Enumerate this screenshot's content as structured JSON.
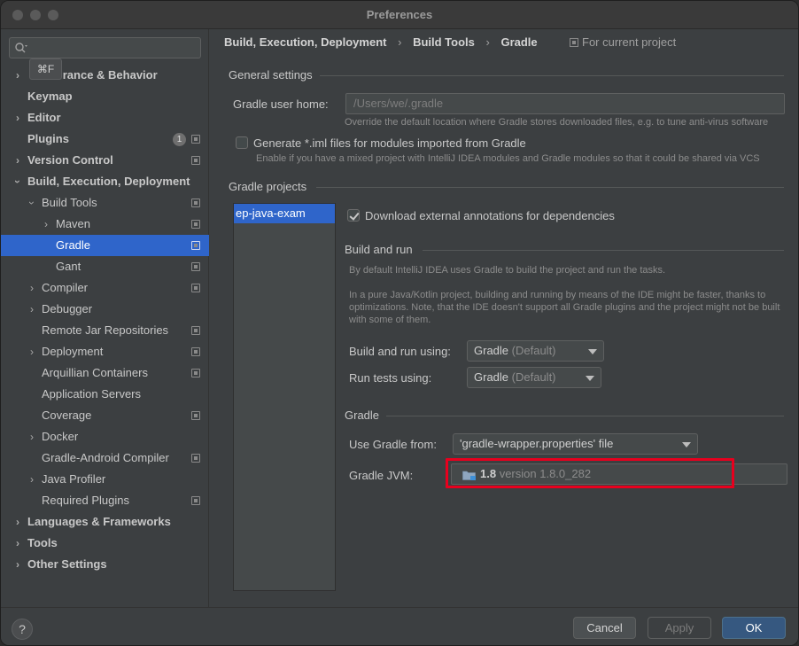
{
  "window": {
    "title": "Preferences"
  },
  "search": {
    "placeholder": "",
    "shortcut_tooltip": "⌘F"
  },
  "sidebar": {
    "items": [
      {
        "label": "Appearance & Behavior",
        "visible_label": "rance & Behavior"
      },
      {
        "label": "Keymap"
      },
      {
        "label": "Editor"
      },
      {
        "label": "Plugins",
        "badge": "1"
      },
      {
        "label": "Version Control"
      },
      {
        "label": "Build, Execution, Deployment"
      },
      {
        "label": "Build Tools"
      },
      {
        "label": "Maven"
      },
      {
        "label": "Gradle"
      },
      {
        "label": "Gant"
      },
      {
        "label": "Compiler"
      },
      {
        "label": "Debugger"
      },
      {
        "label": "Remote Jar Repositories"
      },
      {
        "label": "Deployment"
      },
      {
        "label": "Arquillian Containers"
      },
      {
        "label": "Application Servers"
      },
      {
        "label": "Coverage"
      },
      {
        "label": "Docker"
      },
      {
        "label": "Gradle-Android Compiler"
      },
      {
        "label": "Java Profiler"
      },
      {
        "label": "Required Plugins"
      },
      {
        "label": "Languages & Frameworks"
      },
      {
        "label": "Tools"
      },
      {
        "label": "Other Settings"
      }
    ]
  },
  "breadcrumb": {
    "parts": [
      "Build, Execution, Deployment",
      "Build Tools",
      "Gradle"
    ],
    "separator": "›",
    "scope": "For current project"
  },
  "general": {
    "title": "General settings",
    "user_home_label": "Gradle user home:",
    "user_home_placeholder": "/Users/we/.gradle",
    "user_home_hint": "Override the default location where Gradle stores downloaded files, e.g. to tune anti-virus software",
    "iml_label": "Generate *.iml files for modules imported from Gradle",
    "iml_checked": false,
    "iml_hint": "Enable if you have a mixed project with IntelliJ IDEA modules and Gradle modules so that it could be shared via VCS"
  },
  "projects": {
    "title": "Gradle projects",
    "list": [
      "ep-java-exam"
    ],
    "download_annotations_label": "Download external annotations for dependencies",
    "download_annotations_checked": true,
    "build_run": {
      "title": "Build and run",
      "hint1": "By default IntelliJ IDEA uses Gradle to build the project and run the tasks.",
      "hint2_line1": "In a pure Java/Kotlin project, building and running by means of the IDE might be faster, thanks to",
      "hint2_line2": "optimizations. Note, that the IDE doesn't support all Gradle plugins and the project might not be built",
      "hint2_line3": "with some of them.",
      "build_using_label": "Build and run using:",
      "build_using_value": "Gradle",
      "build_using_suffix": "(Default)",
      "tests_using_label": "Run tests using:",
      "tests_using_value": "Gradle",
      "tests_using_suffix": "(Default)"
    },
    "gradle": {
      "title": "Gradle",
      "use_from_label": "Use Gradle from:",
      "use_from_value": "'gradle-wrapper.properties' file",
      "jvm_label": "Gradle JVM:",
      "jvm_value": "1.8",
      "jvm_version": "version 1.8.0_282"
    }
  },
  "footer": {
    "help": "?",
    "cancel": "Cancel",
    "apply": "Apply",
    "ok": "OK"
  },
  "colors": {
    "selection": "#2f65ca",
    "highlight": "#e8001e",
    "primary_button": "#365880"
  }
}
